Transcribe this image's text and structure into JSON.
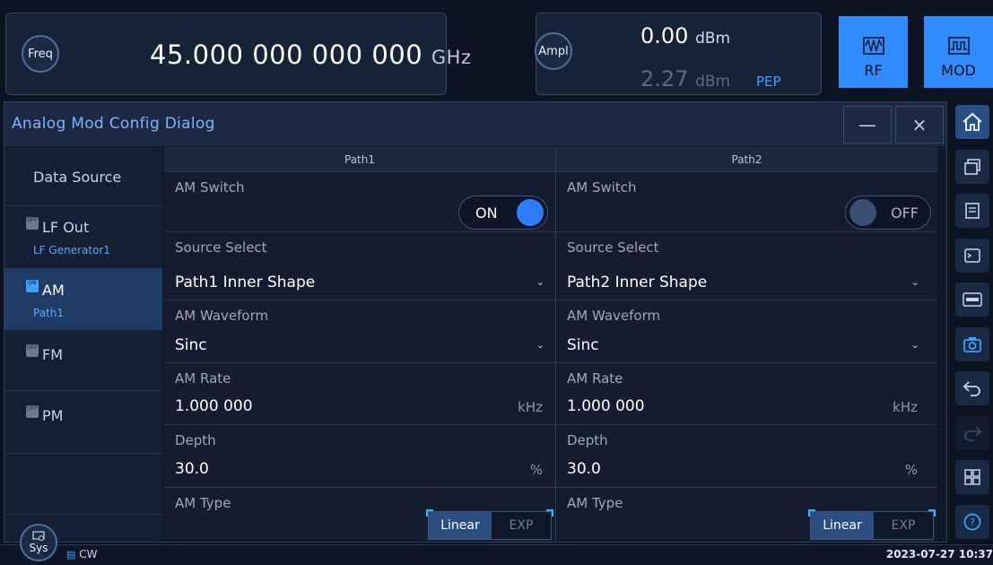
{
  "header": {
    "freq_label": "Freq",
    "freq_value": "45.000 000 000 000",
    "freq_unit": "GHz",
    "ampl_label": "Ampl",
    "ampl_value": "0.00",
    "ampl_unit": "dBm",
    "ampl_pep_value": "2.27",
    "ampl_pep_unit": "dBm",
    "pep_label": "PEP",
    "rf_label": "RF",
    "mod_label": "MOD"
  },
  "dialog": {
    "title": "Analog Mod Config Dialog",
    "minimize_label": "—",
    "close_label": "×"
  },
  "nav": {
    "items": [
      {
        "label": "Data Source",
        "sub": "",
        "state": ""
      },
      {
        "label": "LF Out",
        "sub": "LF Generator1",
        "state": "OFF"
      },
      {
        "label": "AM",
        "sub": "Path1",
        "state": "ON"
      },
      {
        "label": "FM",
        "sub": "",
        "state": "OFF"
      },
      {
        "label": "PM",
        "sub": "",
        "state": "OFF"
      }
    ]
  },
  "paths": [
    {
      "header": "Path1",
      "am_switch_label": "AM Switch",
      "am_switch_value": "ON",
      "source_label": "Source Select",
      "source_value": "Path1 Inner Shape",
      "waveform_label": "AM Waveform",
      "waveform_value": "Sinc",
      "rate_label": "AM Rate",
      "rate_value": "1.000 000",
      "rate_unit": "kHz",
      "depth_label": "Depth",
      "depth_value": "30.0",
      "depth_unit": "%",
      "type_label": "AM Type",
      "type_options": [
        "Linear",
        "EXP"
      ]
    },
    {
      "header": "Path2",
      "am_switch_label": "AM Switch",
      "am_switch_value": "OFF",
      "source_label": "Source Select",
      "source_value": "Path2 Inner Shape",
      "waveform_label": "AM Waveform",
      "waveform_value": "Sinc",
      "rate_label": "AM Rate",
      "rate_value": "1.000 000",
      "rate_unit": "kHz",
      "depth_label": "Depth",
      "depth_value": "30.0",
      "depth_unit": "%",
      "type_label": "AM Type",
      "type_options": [
        "Linear",
        "EXP"
      ]
    }
  ],
  "toolbar": {
    "icons": [
      "home-icon",
      "windows-icon",
      "panel-icon",
      "scpi-console-icon",
      "scpi-icon",
      "camera-icon",
      "undo-icon",
      "redo-icon",
      "layout-icon",
      "help-icon"
    ]
  },
  "status": {
    "sys_label": "Sys",
    "mode": "CW",
    "clock": "2023-07-27 10:37"
  },
  "colors": {
    "accent": "#2f8bff",
    "highlight": "#3fa1ff",
    "background": "#0b1220"
  }
}
